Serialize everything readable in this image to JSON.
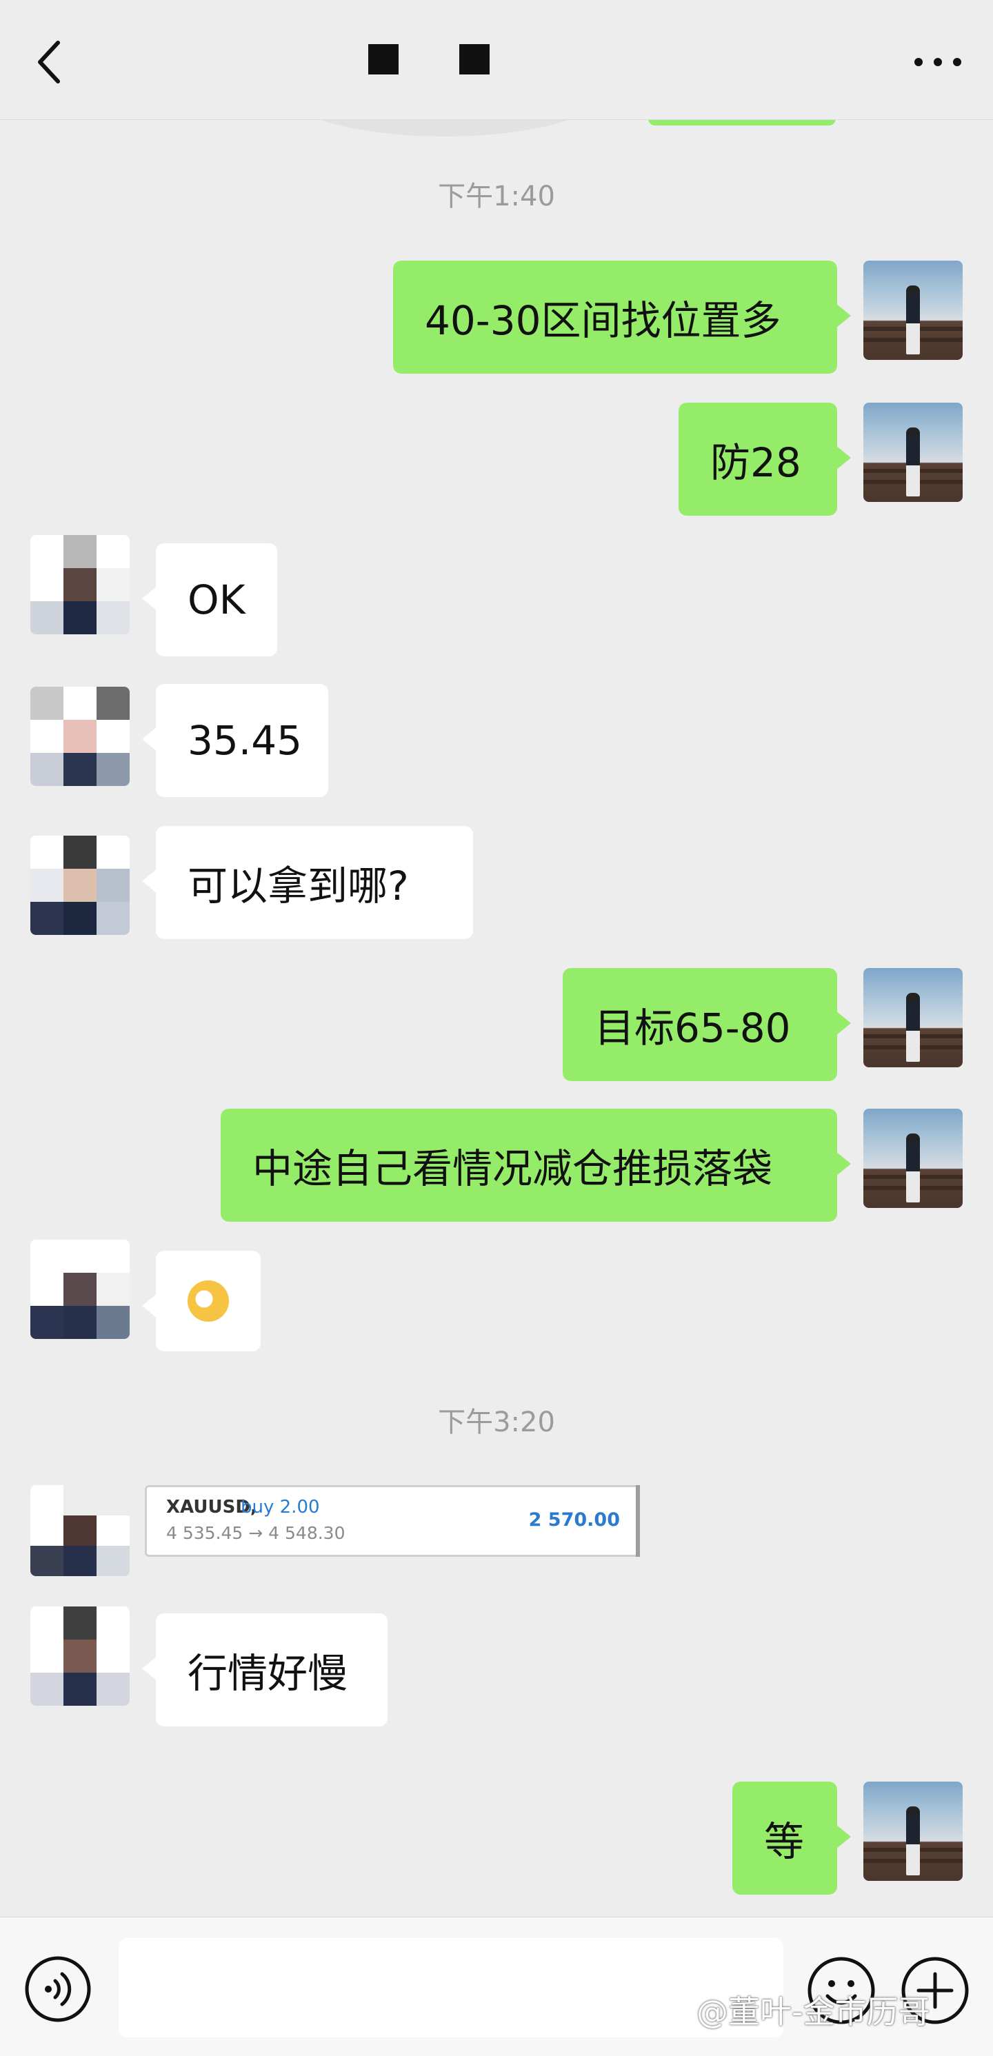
{
  "header": {
    "back_icon": "chevron-left-icon",
    "more_icon": "more-dots-icon"
  },
  "timestamps": [
    "下午1:40",
    "下午3:20"
  ],
  "messages": [
    {
      "side": "me",
      "text": "40-30区间找位置多"
    },
    {
      "side": "me",
      "text": "防28"
    },
    {
      "side": "them",
      "text": "OK"
    },
    {
      "side": "them",
      "text": "35.45"
    },
    {
      "side": "them",
      "text": "可以拿到哪?"
    },
    {
      "side": "me",
      "text": "目标65-80"
    },
    {
      "side": "me",
      "text": "中途自己看情况减仓推损落袋"
    },
    {
      "side": "them",
      "emoji": "ok-hand-emoji"
    },
    {
      "side": "them",
      "trade": {
        "symbol": "XAUUSD,",
        "side": "buy 2.00",
        "prices": "4 535.45 → 4 548.30",
        "profit": "2 570.00"
      }
    },
    {
      "side": "them",
      "text": "行情好慢"
    },
    {
      "side": "me",
      "text": "等"
    }
  ],
  "bottom_bar": {
    "voice_icon": "voice-icon",
    "emoji_icon": "emoji-icon",
    "plus_icon": "plus-icon",
    "watermark": "@董叶-金市历哥"
  },
  "colors": {
    "background": "#ededed",
    "my_bubble": "#95ec69",
    "their_bubble": "#ffffff",
    "timestamp_text": "#9b9b9b",
    "trade_blue": "#2a7ad0"
  }
}
